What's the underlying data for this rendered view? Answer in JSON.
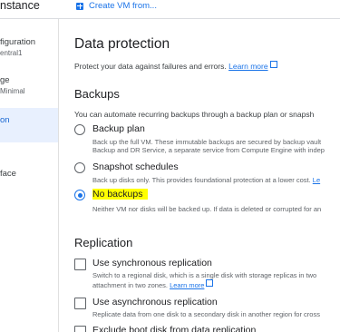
{
  "header": {
    "title": "nstance",
    "create_vm": "Create VM from..."
  },
  "sidenav": {
    "items": [
      {
        "label": "figuration",
        "sub": "entral1"
      },
      {
        "label": "ge",
        "sub": "Minimal"
      },
      {
        "label": "on",
        "sub": ""
      },
      {
        "label": "face",
        "sub": ""
      }
    ]
  },
  "data_protection": {
    "title": "Data protection",
    "desc": "Protect your data against failures and errors.",
    "learn_more": "Learn more"
  },
  "backups": {
    "title": "Backups",
    "desc": "You can automate recurring backups through a backup plan or snapsh",
    "options": [
      {
        "label": "Backup plan",
        "desc1": "Back up the full VM. These immutable backups are secured by backup vault",
        "desc2": "Backup and DR Service, a separate service from Compute Engine with indep",
        "checked": false
      },
      {
        "label": "Snapshot schedules",
        "desc1": "Back up disks only. This provides foundational protection at a lower cost.",
        "desc_link": "Le",
        "checked": false
      },
      {
        "label": "No backups",
        "desc1": "Neither VM nor disks will be backed up. If data is deleted or corrupted for an",
        "checked": true
      }
    ]
  },
  "replication": {
    "title": "Replication",
    "options": [
      {
        "label": "Use synchronous replication",
        "desc1": "Switch to a regional disk, which is a single disk with storage replicas in two",
        "desc2": "attachment in two zones.",
        "learn_more": "Learn more"
      },
      {
        "label": "Use asynchronous replication",
        "desc1": "Replicate data from one disk to a secondary disk in another region for cross"
      },
      {
        "label": "Exclude boot disk from data replication"
      }
    ]
  }
}
